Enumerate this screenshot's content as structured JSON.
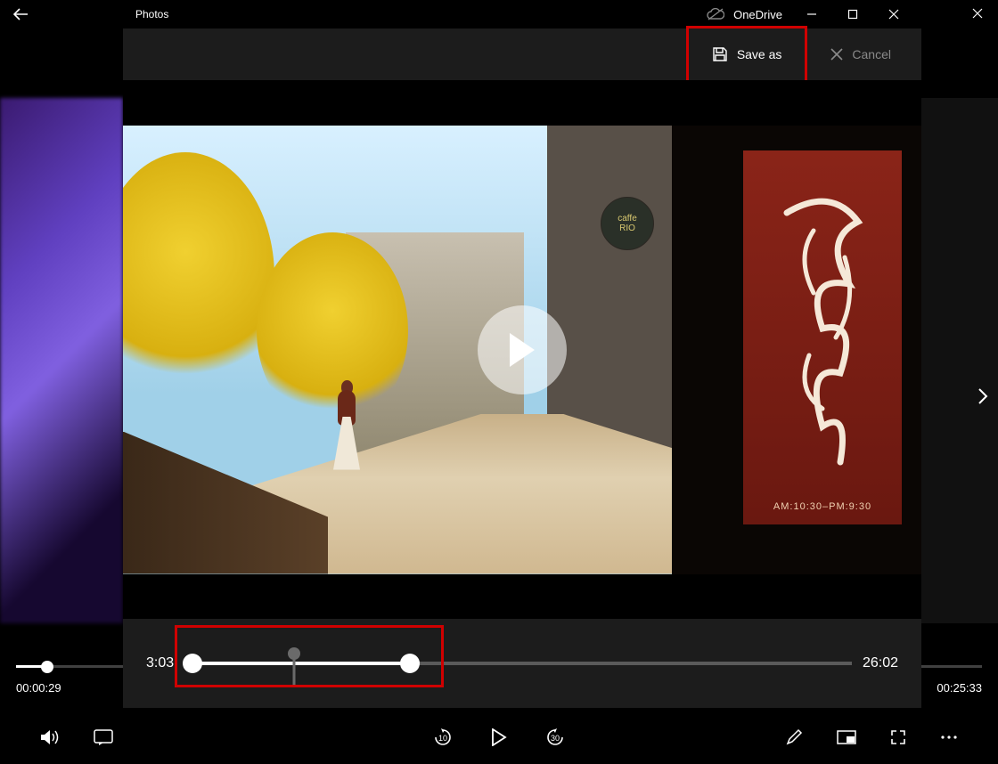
{
  "outer_window": {
    "close_icon": "close",
    "current_time": "00:00:29",
    "total_time": "00:25:33"
  },
  "dialog": {
    "app_title": "Photos",
    "cloud_label": "OneDrive",
    "toolbar": {
      "save_label": "Save as",
      "cancel_label": "Cancel"
    }
  },
  "scene": {
    "cafe_top": "caffe",
    "cafe_name": "RIO",
    "sign_hours": "AM:10:30–PM:9:30"
  },
  "trim": {
    "start_time": "3:03",
    "end_time": "26:02"
  }
}
